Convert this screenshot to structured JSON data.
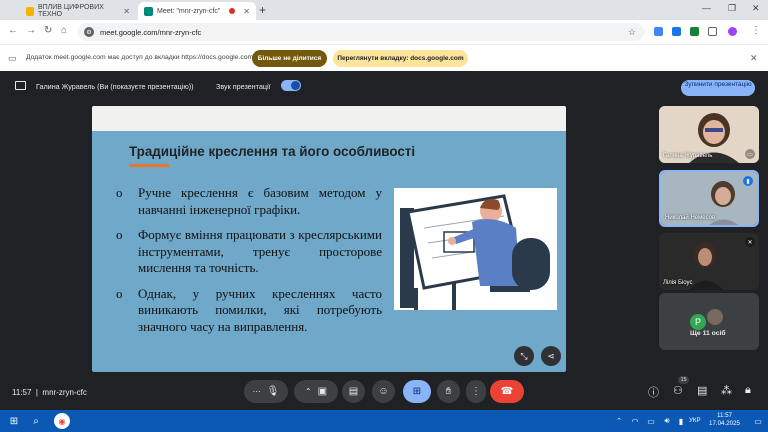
{
  "browser": {
    "tabs": [
      {
        "title": "ВПЛИВ ЦИФРОВИХ ТЕХНО",
        "active": false,
        "favicon_color": "#f4b400"
      },
      {
        "title": "Meet: \"mnr-zryn-cfc\"",
        "active": true,
        "favicon_color": "#00897b"
      }
    ],
    "url": "meet.google.com/mnr-zryn-cfc",
    "infobar": {
      "text": "Додаток meet.google.com має доступ до вкладки https://docs.google.com",
      "stop_sharing": "Більше не ділитися",
      "view_tab": "Переглянути вкладку: docs.google.com"
    }
  },
  "meet": {
    "presenter": "Галина Журавель (Ви (показуєте презентацію))",
    "sound_label": "Звук презентації",
    "sound_on": true,
    "stop_presenting": "Зупинити презентацію",
    "meeting_time": "11:57",
    "meeting_code": "mnr-zryn-cfc",
    "participants_badge": "15",
    "participants": [
      {
        "name": "Галина Журавель"
      },
      {
        "name": "Николай Немесов"
      },
      {
        "name": "Лілія Біоус"
      }
    ],
    "more_label": "Ще 11 осіб",
    "more_avatar_letter": "P"
  },
  "slide": {
    "title": "Традиційне креслення та його особливості",
    "bullet_marker": "o",
    "bullets": [
      "Ручне креслення є базовим методом у навчанні інженерної графіки.",
      "Формує вміння працювати з креслярськими інструментами, тренує просторове мислення та точність.",
      "Однак, у ручних кресленнях часто виникають помилки, які потребують значного часу на виправлення."
    ],
    "accent_color": "#e8772e",
    "background_color": "#6fa8c8"
  },
  "taskbar": {
    "lang": "УКР",
    "time": "11:57",
    "date": "17.04.2025"
  }
}
